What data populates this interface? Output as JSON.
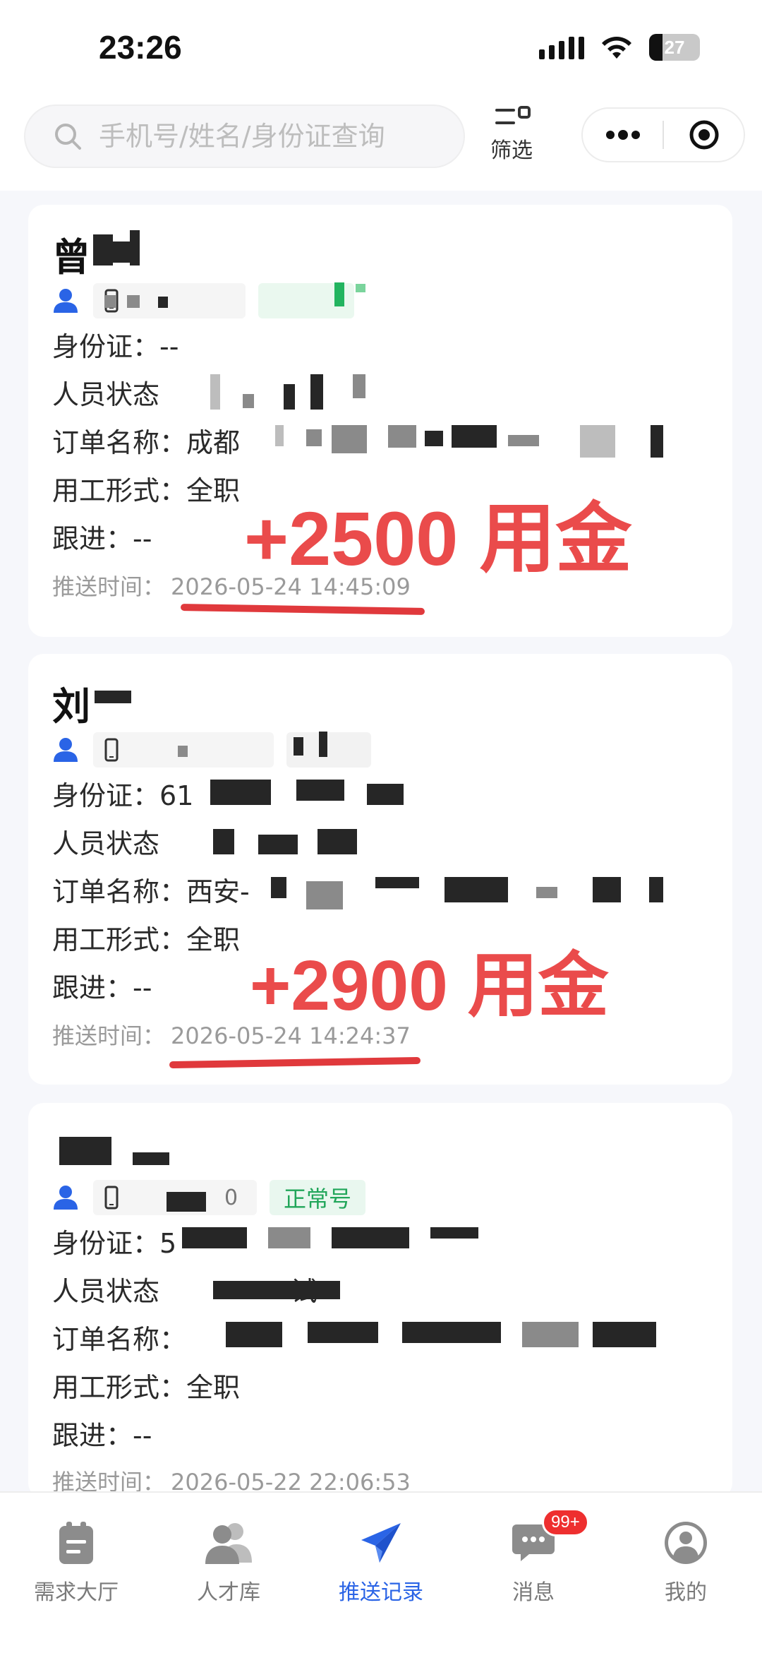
{
  "status_bar": {
    "time": "23:26",
    "battery": "27"
  },
  "search": {
    "placeholder": "手机号/姓名/身份证查询"
  },
  "filter": {
    "label": "筛选"
  },
  "labels": {
    "id_card": "身份证：",
    "person_status": "人员状态",
    "order_name": "订单名称：",
    "employment_type": "用工形式：",
    "follow_up": "跟进：",
    "push_time": "推送时间："
  },
  "records": [
    {
      "name": "曾",
      "id_card": "--",
      "order_name": "成都",
      "employment_type": "全职",
      "follow_up": "--",
      "push_time": "2026-05-24 14:45:09",
      "annotation": "+2500 用金"
    },
    {
      "name": "刘",
      "id_card": "61",
      "order_name": "西安-",
      "employment_type": "全职",
      "follow_up": "--",
      "push_time": "2026-05-24 14:24:37",
      "annotation": "+2900 用金"
    },
    {
      "phone": "0",
      "tag": "正常号",
      "id_card": "5",
      "person_status": "试",
      "order_name": "",
      "employment_type": "全职",
      "follow_up": "--",
      "push_time": "2026-05-22 22:06:53"
    }
  ],
  "tabs": [
    {
      "label": "需求大厅",
      "icon": "demand-hall-icon"
    },
    {
      "label": "人才库",
      "icon": "talent-pool-icon"
    },
    {
      "label": "推送记录",
      "icon": "push-record-icon",
      "active": true
    },
    {
      "label": "消息",
      "icon": "message-icon",
      "badge": "99+"
    },
    {
      "label": "我的",
      "icon": "profile-icon"
    }
  ],
  "colors": {
    "accent": "#2a64e6",
    "annotation": "#ea4b4b",
    "tag_green": "#21a65a",
    "badge": "#ee2f2f"
  }
}
